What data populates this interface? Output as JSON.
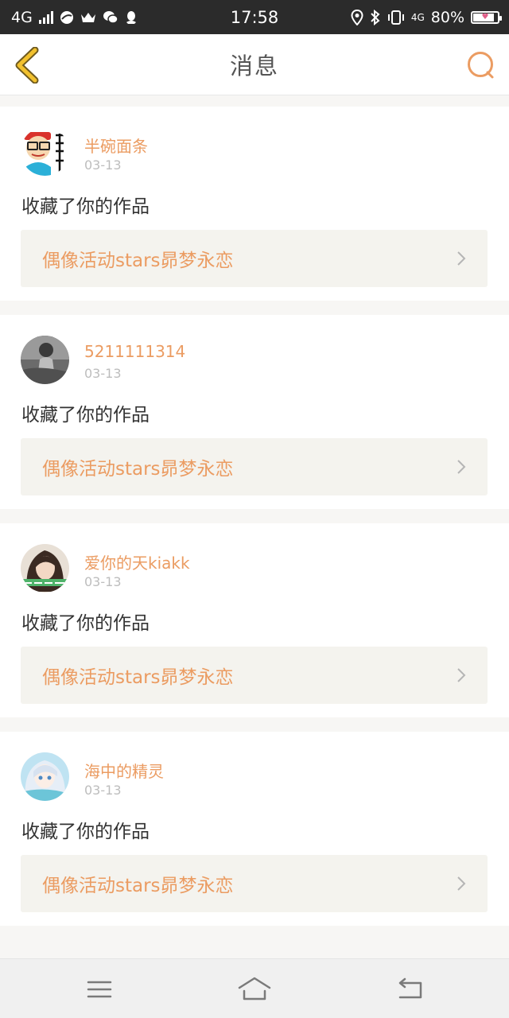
{
  "status_bar": {
    "network": "4G",
    "time": "17:58",
    "network2": "4G",
    "battery_text": "80%",
    "battery_level": 0.8,
    "icons": [
      "signal-icon",
      "browser-icon",
      "crown-icon",
      "wechat-icon",
      "qq-icon",
      "location-icon",
      "bluetooth-icon",
      "vibrate-icon",
      "battery-icon"
    ]
  },
  "header": {
    "title": "消息",
    "back_icon": "chevron-left-icon",
    "search_icon": "search-icon"
  },
  "colors": {
    "accent": "#eb9c62",
    "back_icon_fill": "#f2c12e",
    "back_icon_stroke": "#6e5a20",
    "status_bar_bg": "#2b2b2b",
    "card_link_bg": "#f4f3ee",
    "page_bg": "#f7f6f4"
  },
  "notifications": [
    {
      "user": "半碗面条",
      "date": "03-13",
      "action": "收藏了你的作品",
      "work_title": "偶像活动stars昴梦永恋",
      "avatar_icon": "cartoon-avatar"
    },
    {
      "user": "5211111314",
      "date": "03-13",
      "action": "收藏了你的作品",
      "work_title": "偶像活动stars昴梦永恋",
      "avatar_icon": "grayscale-photo-avatar"
    },
    {
      "user": "爱你的天kiakk",
      "date": "03-13",
      "action": "收藏了你的作品",
      "work_title": "偶像活动stars昴梦永恋",
      "avatar_icon": "girl-photo-avatar"
    },
    {
      "user": "海中的精灵",
      "date": "03-13",
      "action": "收藏了你的作品",
      "work_title": "偶像活动stars昴梦永恋",
      "avatar_icon": "anime-girl-avatar"
    }
  ],
  "bottom_nav": {
    "items": [
      "menu-icon",
      "home-icon",
      "back-icon"
    ]
  }
}
